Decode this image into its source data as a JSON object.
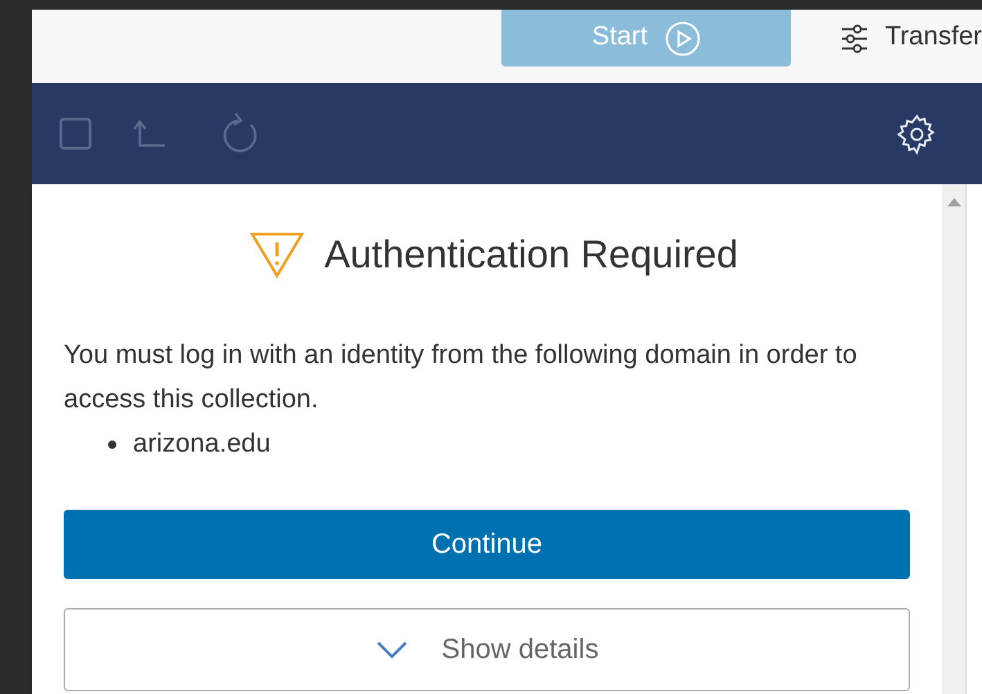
{
  "top_bar": {
    "start_button": "Start",
    "transfer_options": "Transfer"
  },
  "toolbar": {
    "select_all": {
      "checked": false,
      "disabled": true
    }
  },
  "dialog": {
    "title": "Authentication Required",
    "message": "You must log in with an identity from the following domain in order to access this collection.",
    "domains": [
      "arizona.edu"
    ],
    "continue_button": "Continue",
    "details_toggle": {
      "label": "Show details",
      "expanded": false
    }
  }
}
